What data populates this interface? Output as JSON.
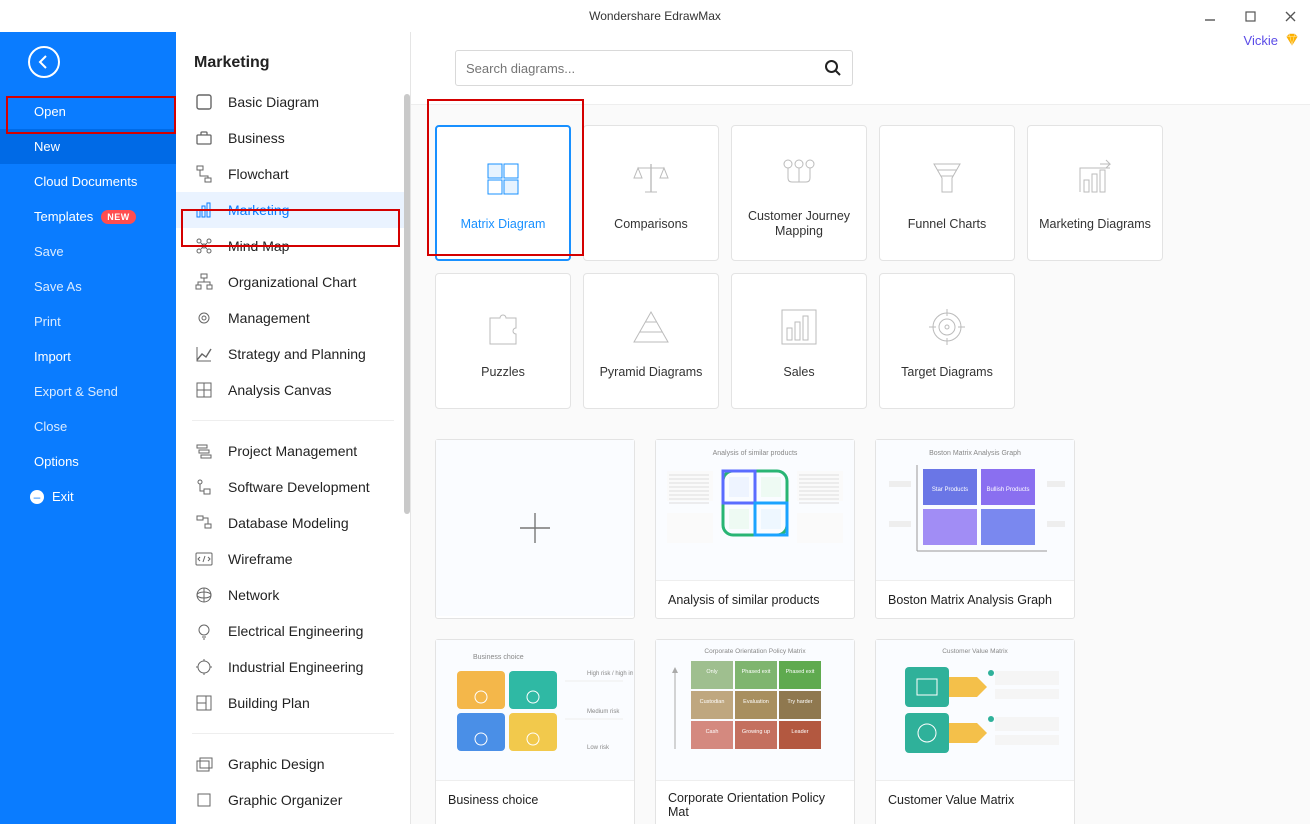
{
  "app_title": "Wondershare EdrawMax",
  "user": {
    "name": "Vickie"
  },
  "sidebar": {
    "items": [
      {
        "label": "Open",
        "bright": true
      },
      {
        "label": "New",
        "active": true,
        "bright": true
      },
      {
        "label": "Cloud Documents",
        "bright": true
      },
      {
        "label": "Templates",
        "badge": "NEW",
        "bright": true
      },
      {
        "label": "Save"
      },
      {
        "label": "Save As"
      },
      {
        "label": "Print"
      },
      {
        "label": "Import",
        "bright": true
      },
      {
        "label": "Export & Send"
      },
      {
        "label": "Close"
      },
      {
        "label": "Options",
        "bright": true
      }
    ],
    "exit": "Exit"
  },
  "col2": {
    "title": "Marketing",
    "groups": [
      [
        {
          "label": "Basic Diagram",
          "icon": "square"
        },
        {
          "label": "Business",
          "icon": "briefcase"
        },
        {
          "label": "Flowchart",
          "icon": "flow"
        },
        {
          "label": "Marketing",
          "icon": "bars",
          "active": true
        },
        {
          "label": "Mind Map",
          "icon": "mind"
        },
        {
          "label": "Organizational Chart",
          "icon": "org"
        },
        {
          "label": "Management",
          "icon": "gear"
        },
        {
          "label": "Strategy and Planning",
          "icon": "chart"
        },
        {
          "label": "Analysis Canvas",
          "icon": "grid"
        }
      ],
      [
        {
          "label": "Project Management",
          "icon": "gantt"
        },
        {
          "label": "Software Development",
          "icon": "flow2"
        },
        {
          "label": "Database Modeling",
          "icon": "db"
        },
        {
          "label": "Wireframe",
          "icon": "code"
        },
        {
          "label": "Network",
          "icon": "net"
        },
        {
          "label": "Electrical Engineering",
          "icon": "bulb"
        },
        {
          "label": "Industrial Engineering",
          "icon": "cog"
        },
        {
          "label": "Building Plan",
          "icon": "plan"
        }
      ],
      [
        {
          "label": "Graphic Design",
          "icon": "layers"
        },
        {
          "label": "Graphic Organizer",
          "icon": "org2"
        }
      ]
    ]
  },
  "search": {
    "placeholder": "Search diagrams..."
  },
  "tiles": [
    {
      "label": "Matrix Diagram",
      "icon": "matrix",
      "selected": true
    },
    {
      "label": "Comparisons",
      "icon": "scale"
    },
    {
      "label": "Customer Journey Mapping",
      "icon": "journey"
    },
    {
      "label": "Funnel Charts",
      "icon": "funnel"
    },
    {
      "label": "Marketing Diagrams",
      "icon": "marketing"
    },
    {
      "label": "Puzzles",
      "icon": "puzzle"
    },
    {
      "label": "Pyramid Diagrams",
      "icon": "pyramid"
    },
    {
      "label": "Sales",
      "icon": "salesbar"
    },
    {
      "label": "Target Diagrams",
      "icon": "target"
    }
  ],
  "templates": [
    {
      "label": "",
      "blank": true
    },
    {
      "label": "Analysis of similar products",
      "style": "similar"
    },
    {
      "label": "Boston Matrix Analysis Graph",
      "style": "boston"
    },
    {
      "label": "Business choice",
      "style": "choice"
    },
    {
      "label": "Corporate Orientation Policy Mat",
      "style": "orient"
    },
    {
      "label": "Customer Value Matrix",
      "style": "value"
    }
  ]
}
